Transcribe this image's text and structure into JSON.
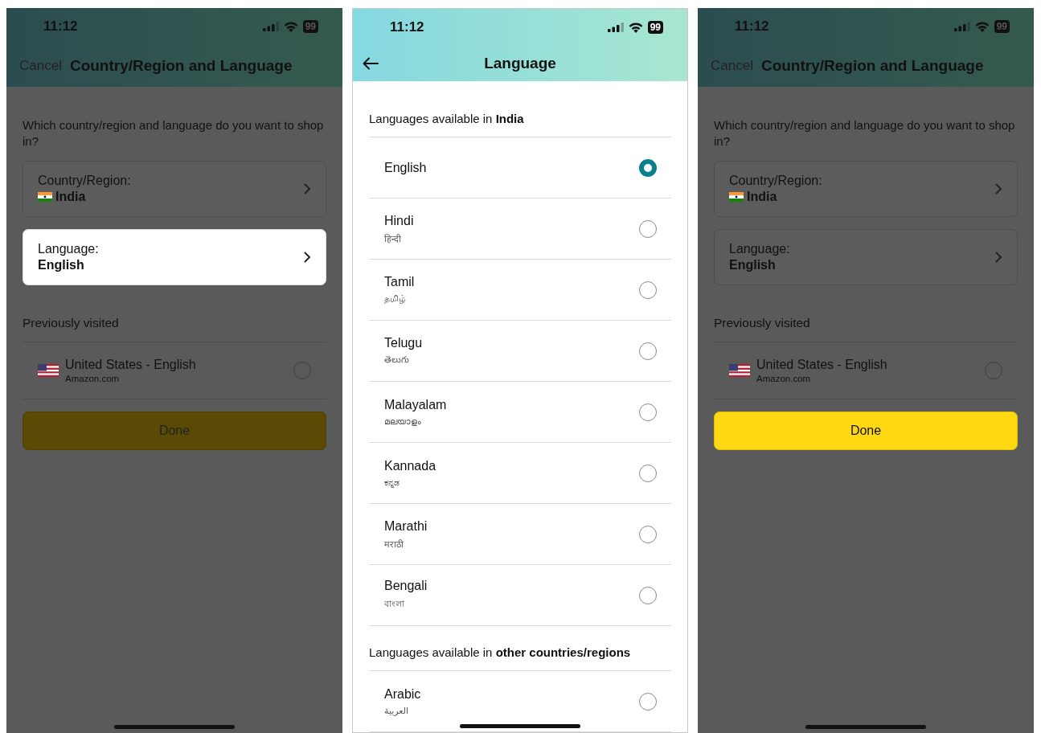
{
  "screens": [
    {
      "kind": "region_settings",
      "dimmed": true,
      "status_bar": {
        "time": "11:12",
        "battery": "99"
      },
      "cancel": "Cancel",
      "title": "Country/Region and Language",
      "question": "Which country/region and language do you want to shop in?",
      "fields": [
        {
          "kind": "country",
          "label": "Country/Region:",
          "value": "India",
          "highlighted": false
        },
        {
          "kind": "language",
          "label": "Language:",
          "value": "English",
          "highlighted": true
        }
      ],
      "previously_visited": {
        "heading": "Previously visited",
        "items": [
          {
            "title": "United States - English",
            "subtitle": "Amazon.com",
            "selected": false
          }
        ]
      },
      "done": {
        "label": "Done",
        "highlighted": false
      }
    },
    {
      "kind": "language_list",
      "dimmed": false,
      "status_bar": {
        "time": "11:12",
        "battery": "99"
      },
      "title": "Language",
      "sections": [
        {
          "heading": "Languages available in **India**",
          "items": [
            {
              "name": "English",
              "selected": true
            },
            {
              "name": "Hindi",
              "native": "हिन्दी",
              "selected": false
            },
            {
              "name": "Tamil",
              "native": "தமிழ்",
              "selected": false
            },
            {
              "name": "Telugu",
              "native": "తెలుగు",
              "selected": false
            },
            {
              "name": "Malayalam",
              "native": "മലയാളം",
              "selected": false
            },
            {
              "name": "Kannada",
              "native": "ಕನ್ನಡ",
              "selected": false
            },
            {
              "name": "Marathi",
              "native": "मराठी",
              "selected": false
            },
            {
              "name": "Bengali",
              "native": "বাংলা",
              "selected": false
            }
          ]
        },
        {
          "heading": "Languages available in **other countries/regions**",
          "items": [
            {
              "name": "Arabic",
              "native": "العربية",
              "selected": false
            }
          ]
        }
      ]
    },
    {
      "kind": "region_settings",
      "dimmed": true,
      "status_bar": {
        "time": "11:12",
        "battery": "99"
      },
      "cancel": "Cancel",
      "title": "Country/Region and Language",
      "question": "Which country/region and language do you want to shop in?",
      "fields": [
        {
          "kind": "country",
          "label": "Country/Region:",
          "value": "India",
          "highlighted": false
        },
        {
          "kind": "language",
          "label": "Language:",
          "value": "English",
          "highlighted": false
        }
      ],
      "previously_visited": {
        "heading": "Previously visited",
        "items": [
          {
            "title": "United States - English",
            "subtitle": "Amazon.com",
            "selected": false
          }
        ]
      },
      "done": {
        "label": "Done",
        "highlighted": true
      }
    }
  ]
}
